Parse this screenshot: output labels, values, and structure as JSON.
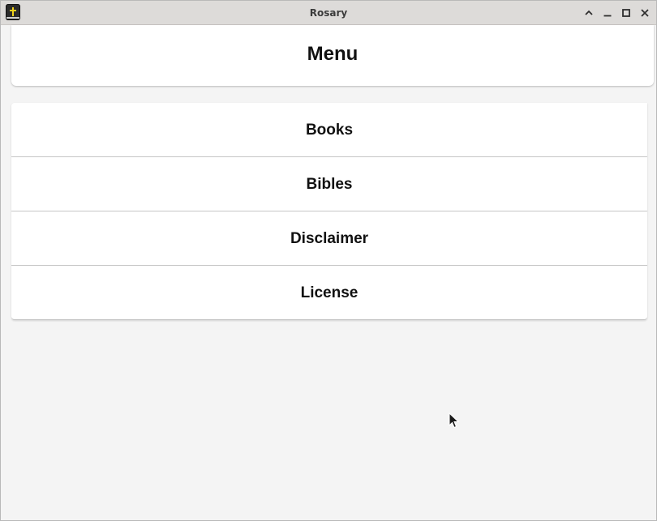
{
  "window": {
    "title": "Rosary",
    "app_icon": "bible-cross-icon",
    "controls": [
      "chevron-up-icon",
      "minimize-icon",
      "maximize-icon",
      "close-icon"
    ]
  },
  "header": {
    "title": "Menu"
  },
  "menu": {
    "items": [
      {
        "label": "Books"
      },
      {
        "label": "Bibles"
      },
      {
        "label": "Disclaimer"
      },
      {
        "label": "License"
      }
    ]
  },
  "colors": {
    "titlebar": "#dddbd9",
    "background": "#f4f4f4",
    "card": "#ffffff",
    "icon_cross": "#f2d21b"
  }
}
